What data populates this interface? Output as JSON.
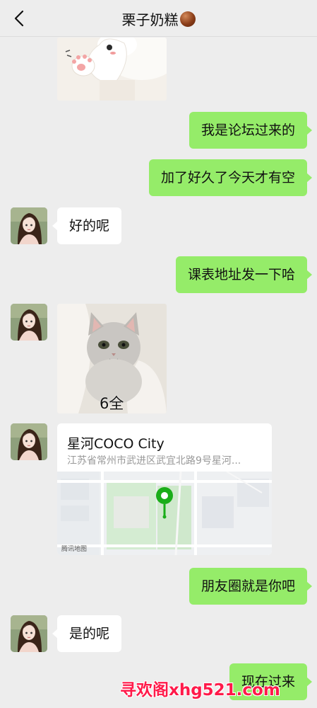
{
  "header": {
    "title": "栗子奶糕",
    "title_icon": "chestnut-emoji-icon",
    "back_icon": "chevron-left-icon"
  },
  "messages": [
    {
      "side": "in",
      "type": "image",
      "image": "cat-paw-sticker"
    },
    {
      "side": "out",
      "type": "text",
      "text": "我是论坛过来的"
    },
    {
      "side": "out",
      "type": "text",
      "text": "加了好久了今天才有空"
    },
    {
      "side": "in",
      "type": "text",
      "text": "好的呢"
    },
    {
      "side": "out",
      "type": "text",
      "text": "课表地址发一下哈"
    },
    {
      "side": "in",
      "type": "image",
      "image": "grey-cat-sticker",
      "caption": "6全"
    },
    {
      "side": "in",
      "type": "location",
      "name": "星河COCO City",
      "address": "江苏省常州市武进区武宜北路9号星河...",
      "map_label": "腾讯地图"
    },
    {
      "side": "out",
      "type": "text",
      "text": "朋友圈就是你吧"
    },
    {
      "side": "in",
      "type": "text",
      "text": "是的呢"
    },
    {
      "side": "out",
      "type": "text",
      "text": "现在过来"
    }
  ],
  "watermark": "寻欢阁xhg521.com",
  "colors": {
    "background": "#ededed",
    "outgoing_bubble": "#95ec69",
    "incoming_bubble": "#ffffff",
    "map_pin": "#1aad19",
    "watermark": "#ff1a4a"
  }
}
